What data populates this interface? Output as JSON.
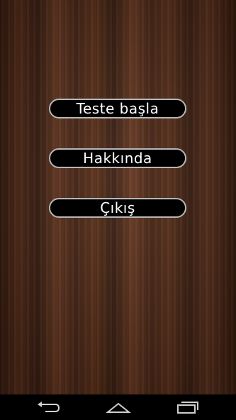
{
  "menu": {
    "start_label": "Teste başla",
    "about_label": "Hakkında",
    "exit_label": "Çıkış"
  },
  "navbar": {
    "back_icon": "back-icon",
    "home_icon": "home-icon",
    "recents_icon": "recents-icon"
  },
  "colors": {
    "button_bg": "#000000",
    "button_border": "#b7b7b7",
    "button_text": "#ffffff",
    "navbar_bg": "#000000"
  }
}
